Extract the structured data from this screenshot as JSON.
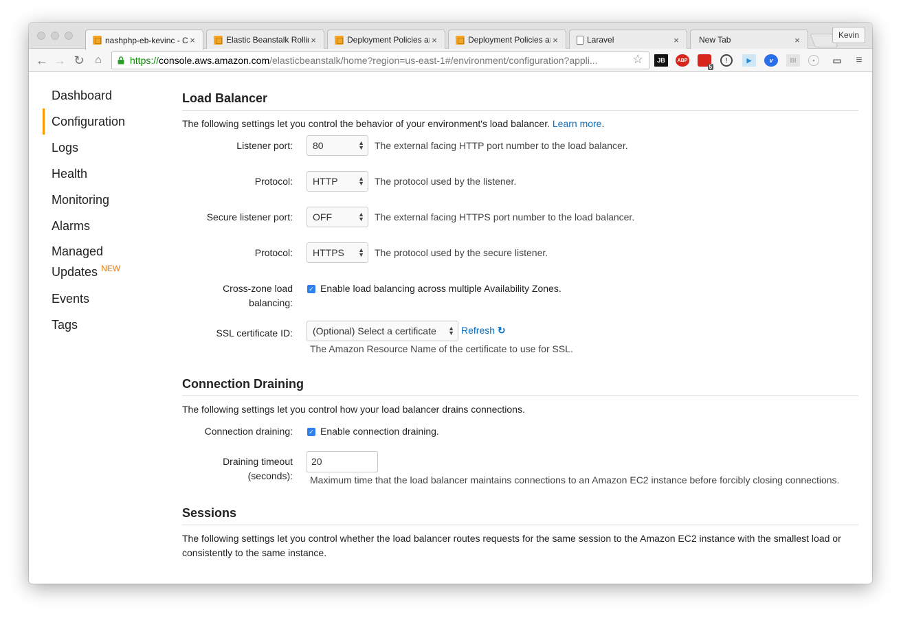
{
  "browser": {
    "tabs": [
      {
        "title": "nashphp-eb-kevinc - C",
        "icon": "aws-cube-icon"
      },
      {
        "title": "Elastic Beanstalk Rollin",
        "icon": "aws-cube-icon"
      },
      {
        "title": "Deployment Policies an",
        "icon": "aws-cube-icon"
      },
      {
        "title": "Deployment Policies an",
        "icon": "aws-cube-icon"
      },
      {
        "title": "Laravel",
        "icon": "document-icon"
      },
      {
        "title": "New Tab",
        "icon": ""
      }
    ],
    "close_glyph": "×",
    "profile_name": "Kevin",
    "url_scheme": "https://",
    "url_host": "console.aws.amazon.com",
    "url_path": "/elasticbeanstalk/home?region=us-east-1#/environment/configuration?appli...",
    "extensions": [
      "JB",
      "ABP",
      "5"
    ]
  },
  "sidebar": {
    "items": [
      {
        "label": "Dashboard"
      },
      {
        "label": "Configuration",
        "active": true
      },
      {
        "label": "Logs"
      },
      {
        "label": "Health"
      },
      {
        "label": "Monitoring"
      },
      {
        "label": "Alarms"
      },
      {
        "label": "Managed",
        "label2": "Updates",
        "badge": "NEW"
      },
      {
        "label": "Events"
      },
      {
        "label": "Tags"
      }
    ]
  },
  "load_balancer": {
    "heading": "Load Balancer",
    "description": "The following settings let you control the behavior of your environment's load balancer.",
    "learn_more": "Learn more",
    "listener_port": {
      "label": "Listener port:",
      "value": "80",
      "help": "The external facing HTTP port number to the load balancer."
    },
    "protocol": {
      "label": "Protocol:",
      "value": "HTTP",
      "help": "The protocol used by the listener."
    },
    "secure_listener_port": {
      "label": "Secure listener port:",
      "value": "OFF",
      "help": "The external facing HTTPS port number to the load balancer."
    },
    "secure_protocol": {
      "label": "Protocol:",
      "value": "HTTPS",
      "help": "The protocol used by the secure listener."
    },
    "cross_zone": {
      "label_line1": "Cross-zone load",
      "label_line2": "balancing:",
      "checkbox_label": "Enable load balancing across multiple Availability Zones.",
      "checked": true
    },
    "ssl_cert": {
      "label": "SSL certificate ID:",
      "value": "(Optional) Select a certificate",
      "refresh": "Refresh",
      "help": "The Amazon Resource Name of the certificate to use for SSL."
    }
  },
  "connection_draining": {
    "heading": "Connection Draining",
    "description": "The following settings let you control how your load balancer drains connections.",
    "draining": {
      "label": "Connection draining:",
      "checkbox_label": "Enable connection draining.",
      "checked": true
    },
    "timeout": {
      "label_line1": "Draining timeout",
      "label_line2": "(seconds):",
      "value": "20",
      "help": "Maximum time that the load balancer maintains connections to an Amazon EC2 instance before forcibly closing connections."
    }
  },
  "sessions": {
    "heading": "Sessions",
    "description": "The following settings let you control whether the load balancer routes requests for the same session to the Amazon EC2 instance with the smallest load or consistently to the same instance."
  }
}
